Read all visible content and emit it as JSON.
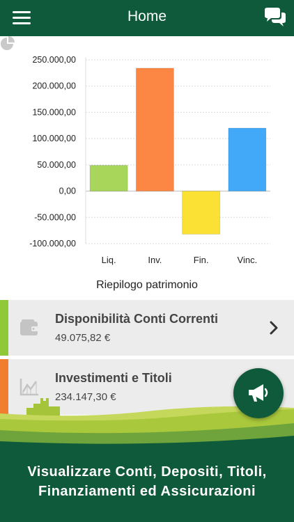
{
  "header": {
    "title": "Home"
  },
  "chart_data": {
    "type": "bar",
    "title": "Riepilogo patrimonio",
    "categories": [
      "Liq.",
      "Inv.",
      "Fin.",
      "Vinc."
    ],
    "values": [
      49075.82,
      234147.3,
      -82000,
      120000
    ],
    "colors": [
      "#a7d65a",
      "#fc8745",
      "#fbe133",
      "#42a9f8"
    ],
    "ylim": [
      -100000,
      250000
    ],
    "yticks": [
      250000,
      200000,
      150000,
      100000,
      50000,
      0,
      -50000,
      -100000
    ],
    "ytick_labels": [
      "250.000,00",
      "200.000,00",
      "150.000,00",
      "100.000,00",
      "50.000,00",
      "0,00",
      "-50.000,00",
      "-100.000,00"
    ],
    "grid": true
  },
  "cards": [
    {
      "label": "Disponibilità Conti Correnti",
      "amount": "49.075,82 €",
      "accent": "#8fc93a"
    },
    {
      "label": "Investimenti e Titoli",
      "amount": "234.147,30 €",
      "accent": "#f07d30"
    }
  ],
  "promo": {
    "line1": "Visualizzare Conti, Depositi, Titoli,",
    "line2": "Finanziamenti ed Assicurazioni"
  },
  "colors": {
    "primary": "#0f5a3a",
    "card_bg": "#ececec"
  }
}
